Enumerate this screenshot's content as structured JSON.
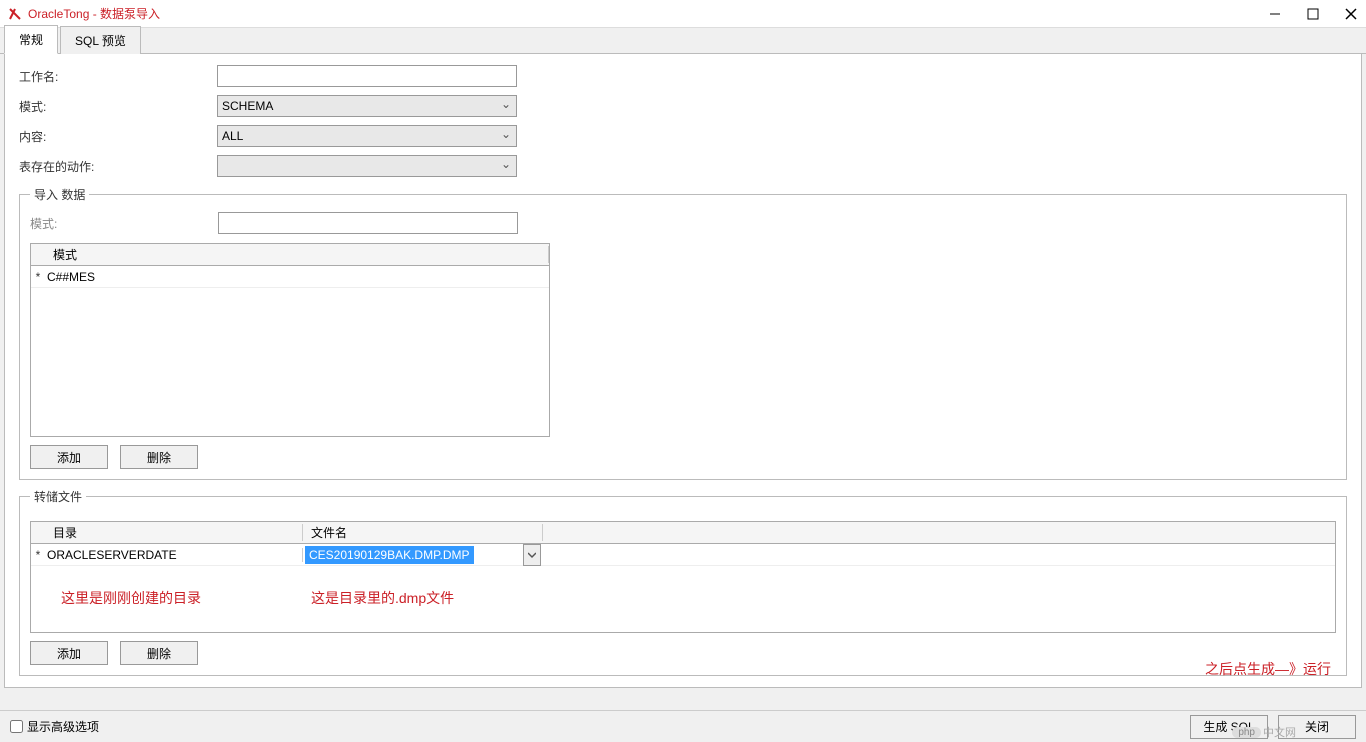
{
  "window": {
    "title": "OracleTong - 数据泵导入"
  },
  "tabs": {
    "general": "常规",
    "sql_preview": "SQL 预览"
  },
  "form": {
    "job_name_label": "工作名:",
    "job_name_value": "",
    "mode_label": "模式:",
    "mode_value": "SCHEMA",
    "content_label": "内容:",
    "content_value": "ALL",
    "table_exists_label": "表存在的动作:",
    "table_exists_value": ""
  },
  "import_data": {
    "legend": "导入 数据",
    "mode_label": "模式:",
    "mode_value": "",
    "table_header": "模式",
    "rows": [
      {
        "marker": "*",
        "value": "C##MES"
      }
    ],
    "add_btn": "添加",
    "delete_btn": "删除"
  },
  "dump_files": {
    "legend": "转储文件",
    "col_dir": "目录",
    "col_file": "文件名",
    "rows": [
      {
        "marker": "*",
        "dir": "ORACLESERVERDATE",
        "file": "CES20190129BAK.DMP.DMP"
      }
    ],
    "annotation_dir": "这里是刚刚创建的目录",
    "annotation_file": "这是目录里的.dmp文件",
    "add_btn": "添加",
    "delete_btn": "删除"
  },
  "annotations": {
    "generate_hint": "之后点生成—》运行"
  },
  "footer": {
    "advanced_checkbox": "显示高级选项",
    "generate_sql_btn": "生成 SQL",
    "close_btn": "关闭"
  },
  "watermark": {
    "badge": "php",
    "text": "中文网"
  }
}
